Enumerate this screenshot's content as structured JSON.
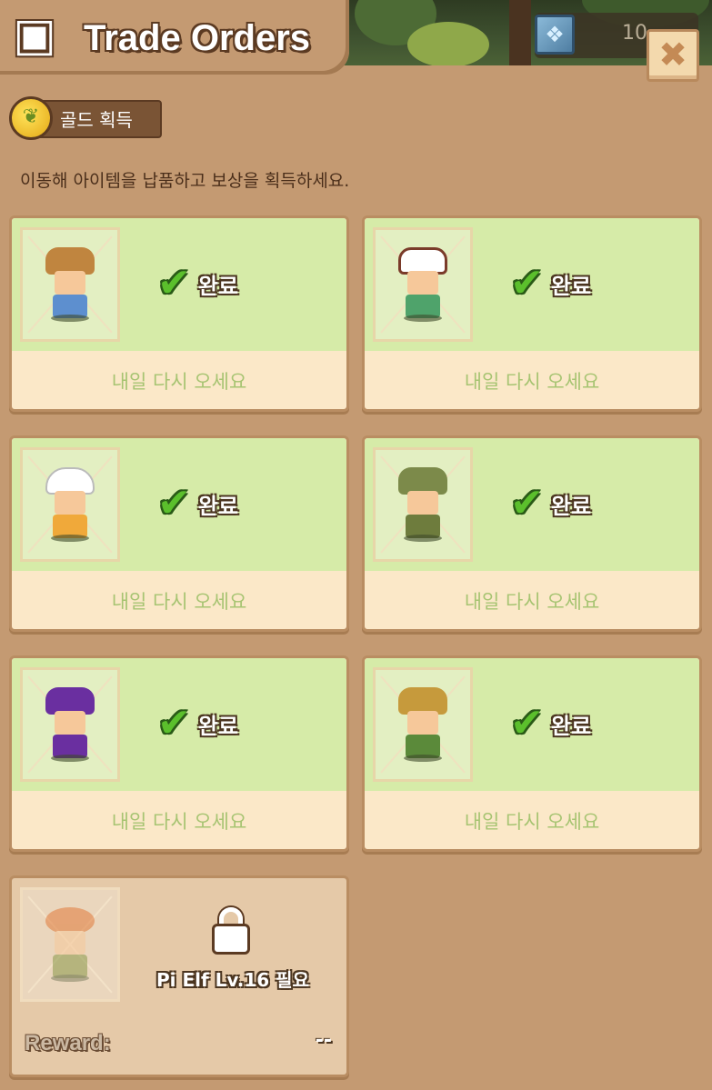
{
  "header": {
    "title": "Trade Orders",
    "box_icon": "box-icon",
    "close_label": "✖",
    "resource_value": "10"
  },
  "gold": {
    "coin_icon": "leaf-coin-icon",
    "label": "골드 획득"
  },
  "description": "이동해 아이템을 납품하고 보상을 획득하세요.",
  "orders": [
    {
      "character": "farmer",
      "status": "완료",
      "message": "내일 다시 오세요"
    },
    {
      "character": "aviator",
      "status": "완료",
      "message": "내일 다시 오세요"
    },
    {
      "character": "chef",
      "status": "완료",
      "message": "내일 다시 오세요"
    },
    {
      "character": "soldier",
      "status": "완료",
      "message": "내일 다시 오세요"
    },
    {
      "character": "wizard",
      "status": "완료",
      "message": "내일 다시 오세요"
    },
    {
      "character": "miner",
      "status": "완료",
      "message": "내일 다시 오세요"
    }
  ],
  "locked_order": {
    "character": "pi-elf",
    "requirement": "Pi Elf Lv.16 필요",
    "reward_label": "Reward:",
    "reward_value": "--"
  },
  "colors": {
    "panel": "#c49a72",
    "card_top": "#d6eba8",
    "card_bottom": "#fbe8c8",
    "check": "#5bbf2c",
    "comeback_text": "#a7c472"
  }
}
